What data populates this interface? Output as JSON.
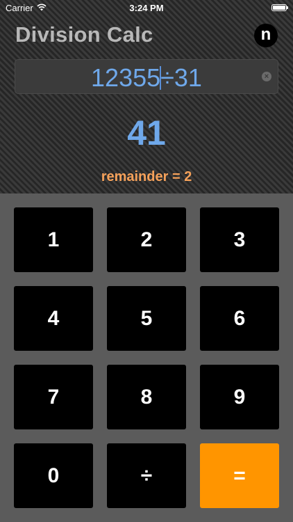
{
  "status_bar": {
    "carrier": "Carrier",
    "time": "3:24 PM",
    "wifi_icon": "wifi-icon",
    "battery_icon": "battery-icon"
  },
  "header": {
    "title": "Division Calc",
    "logo_letter": "n"
  },
  "input": {
    "before_cursor": "12355",
    "after_cursor": "÷31",
    "clear_icon": "clear-circle-icon"
  },
  "result": {
    "quotient": "41",
    "remainder": "remainder = 2"
  },
  "keypad": {
    "keys": [
      "1",
      "2",
      "3",
      "4",
      "5",
      "6",
      "7",
      "8",
      "9",
      "0",
      "÷",
      "="
    ]
  },
  "colors": {
    "accent_blue": "#6fa8ea",
    "remainder_orange": "#f5a15a",
    "equals_orange": "#ff9500",
    "key_black": "#000000",
    "keypad_bg": "#5b5b5b"
  }
}
